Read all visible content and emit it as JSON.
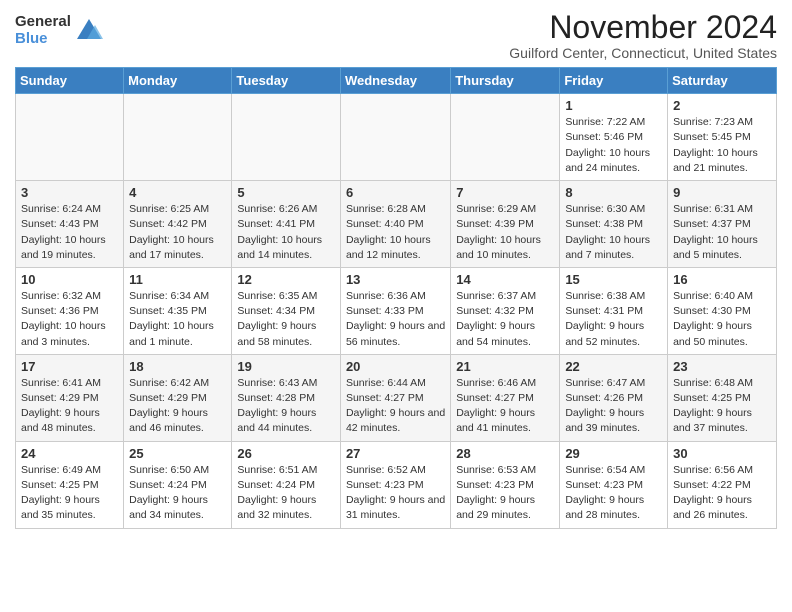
{
  "logo": {
    "general": "General",
    "blue": "Blue"
  },
  "header": {
    "title": "November 2024",
    "subtitle": "Guilford Center, Connecticut, United States"
  },
  "weekdays": [
    "Sunday",
    "Monday",
    "Tuesday",
    "Wednesday",
    "Thursday",
    "Friday",
    "Saturday"
  ],
  "weeks": [
    [
      {
        "day": "",
        "info": ""
      },
      {
        "day": "",
        "info": ""
      },
      {
        "day": "",
        "info": ""
      },
      {
        "day": "",
        "info": ""
      },
      {
        "day": "",
        "info": ""
      },
      {
        "day": "1",
        "info": "Sunrise: 7:22 AM\nSunset: 5:46 PM\nDaylight: 10 hours and 24 minutes."
      },
      {
        "day": "2",
        "info": "Sunrise: 7:23 AM\nSunset: 5:45 PM\nDaylight: 10 hours and 21 minutes."
      }
    ],
    [
      {
        "day": "3",
        "info": "Sunrise: 6:24 AM\nSunset: 4:43 PM\nDaylight: 10 hours and 19 minutes."
      },
      {
        "day": "4",
        "info": "Sunrise: 6:25 AM\nSunset: 4:42 PM\nDaylight: 10 hours and 17 minutes."
      },
      {
        "day": "5",
        "info": "Sunrise: 6:26 AM\nSunset: 4:41 PM\nDaylight: 10 hours and 14 minutes."
      },
      {
        "day": "6",
        "info": "Sunrise: 6:28 AM\nSunset: 4:40 PM\nDaylight: 10 hours and 12 minutes."
      },
      {
        "day": "7",
        "info": "Sunrise: 6:29 AM\nSunset: 4:39 PM\nDaylight: 10 hours and 10 minutes."
      },
      {
        "day": "8",
        "info": "Sunrise: 6:30 AM\nSunset: 4:38 PM\nDaylight: 10 hours and 7 minutes."
      },
      {
        "day": "9",
        "info": "Sunrise: 6:31 AM\nSunset: 4:37 PM\nDaylight: 10 hours and 5 minutes."
      }
    ],
    [
      {
        "day": "10",
        "info": "Sunrise: 6:32 AM\nSunset: 4:36 PM\nDaylight: 10 hours and 3 minutes."
      },
      {
        "day": "11",
        "info": "Sunrise: 6:34 AM\nSunset: 4:35 PM\nDaylight: 10 hours and 1 minute."
      },
      {
        "day": "12",
        "info": "Sunrise: 6:35 AM\nSunset: 4:34 PM\nDaylight: 9 hours and 58 minutes."
      },
      {
        "day": "13",
        "info": "Sunrise: 6:36 AM\nSunset: 4:33 PM\nDaylight: 9 hours and 56 minutes."
      },
      {
        "day": "14",
        "info": "Sunrise: 6:37 AM\nSunset: 4:32 PM\nDaylight: 9 hours and 54 minutes."
      },
      {
        "day": "15",
        "info": "Sunrise: 6:38 AM\nSunset: 4:31 PM\nDaylight: 9 hours and 52 minutes."
      },
      {
        "day": "16",
        "info": "Sunrise: 6:40 AM\nSunset: 4:30 PM\nDaylight: 9 hours and 50 minutes."
      }
    ],
    [
      {
        "day": "17",
        "info": "Sunrise: 6:41 AM\nSunset: 4:29 PM\nDaylight: 9 hours and 48 minutes."
      },
      {
        "day": "18",
        "info": "Sunrise: 6:42 AM\nSunset: 4:29 PM\nDaylight: 9 hours and 46 minutes."
      },
      {
        "day": "19",
        "info": "Sunrise: 6:43 AM\nSunset: 4:28 PM\nDaylight: 9 hours and 44 minutes."
      },
      {
        "day": "20",
        "info": "Sunrise: 6:44 AM\nSunset: 4:27 PM\nDaylight: 9 hours and 42 minutes."
      },
      {
        "day": "21",
        "info": "Sunrise: 6:46 AM\nSunset: 4:27 PM\nDaylight: 9 hours and 41 minutes."
      },
      {
        "day": "22",
        "info": "Sunrise: 6:47 AM\nSunset: 4:26 PM\nDaylight: 9 hours and 39 minutes."
      },
      {
        "day": "23",
        "info": "Sunrise: 6:48 AM\nSunset: 4:25 PM\nDaylight: 9 hours and 37 minutes."
      }
    ],
    [
      {
        "day": "24",
        "info": "Sunrise: 6:49 AM\nSunset: 4:25 PM\nDaylight: 9 hours and 35 minutes."
      },
      {
        "day": "25",
        "info": "Sunrise: 6:50 AM\nSunset: 4:24 PM\nDaylight: 9 hours and 34 minutes."
      },
      {
        "day": "26",
        "info": "Sunrise: 6:51 AM\nSunset: 4:24 PM\nDaylight: 9 hours and 32 minutes."
      },
      {
        "day": "27",
        "info": "Sunrise: 6:52 AM\nSunset: 4:23 PM\nDaylight: 9 hours and 31 minutes."
      },
      {
        "day": "28",
        "info": "Sunrise: 6:53 AM\nSunset: 4:23 PM\nDaylight: 9 hours and 29 minutes."
      },
      {
        "day": "29",
        "info": "Sunrise: 6:54 AM\nSunset: 4:23 PM\nDaylight: 9 hours and 28 minutes."
      },
      {
        "day": "30",
        "info": "Sunrise: 6:56 AM\nSunset: 4:22 PM\nDaylight: 9 hours and 26 minutes."
      }
    ]
  ]
}
